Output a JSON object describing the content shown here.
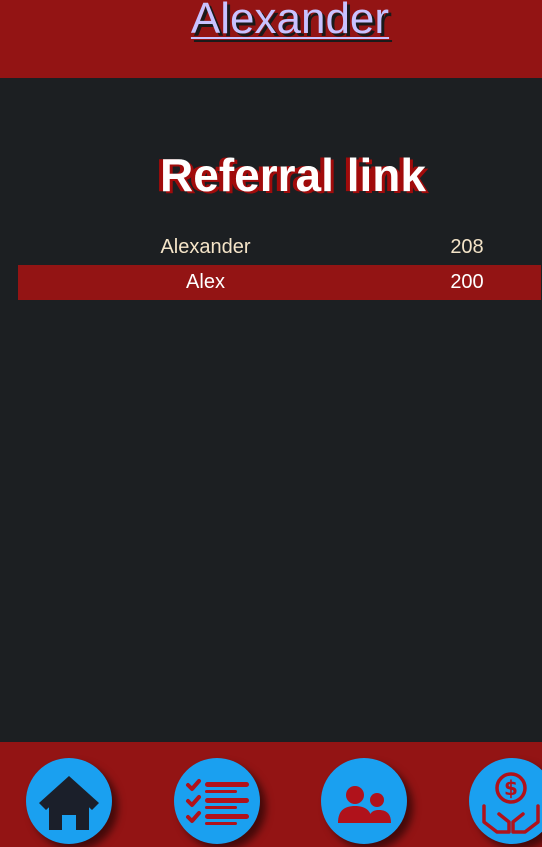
{
  "header": {
    "title": "Alexander"
  },
  "main": {
    "section_title": "Referral link",
    "referrals": [
      {
        "name": "Alexander",
        "value": "208"
      },
      {
        "name": "Alex",
        "value": "200"
      }
    ]
  },
  "bottom_nav": {
    "items": [
      {
        "icon": "home-icon"
      },
      {
        "icon": "task-list-icon"
      },
      {
        "icon": "referrals-icon"
      },
      {
        "icon": "money-hand-icon"
      }
    ]
  },
  "colors": {
    "accent_red": "#931414",
    "background": "#1c1f22",
    "nav_button_blue": "#1aa0f0",
    "icon_red": "#b0121b"
  }
}
